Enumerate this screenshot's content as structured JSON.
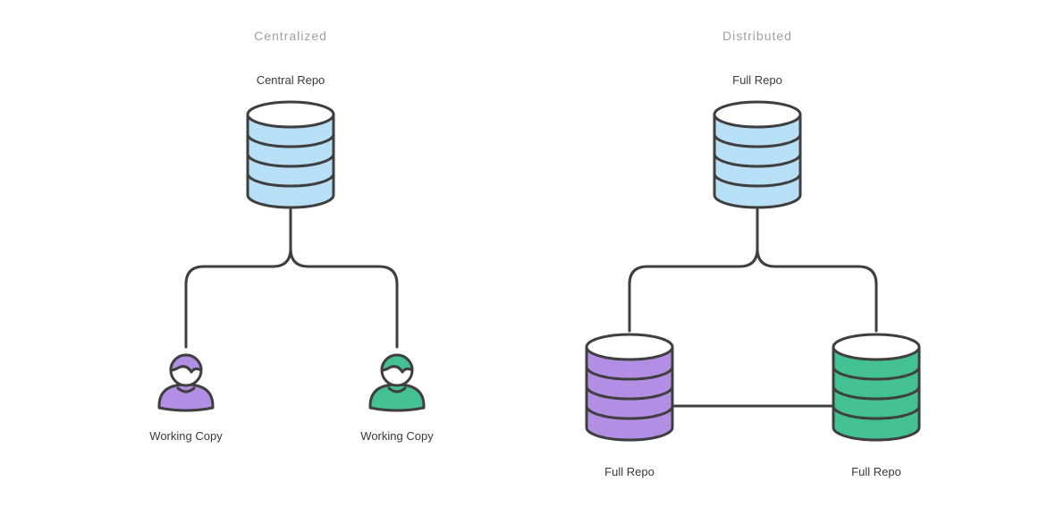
{
  "left": {
    "heading": "Centralized",
    "top_label": "Central Repo",
    "bottom_left_label": "Working Copy",
    "bottom_right_label": "Working Copy"
  },
  "right": {
    "heading": "Distributed",
    "top_label": "Full Repo",
    "bottom_left_label": "Full Repo",
    "bottom_right_label": "Full Repo"
  },
  "colors": {
    "blue": "#b7dff5",
    "purple": "#b28fe4",
    "green": "#43c194",
    "stroke": "#3f3f3f",
    "white": "#ffffff"
  }
}
